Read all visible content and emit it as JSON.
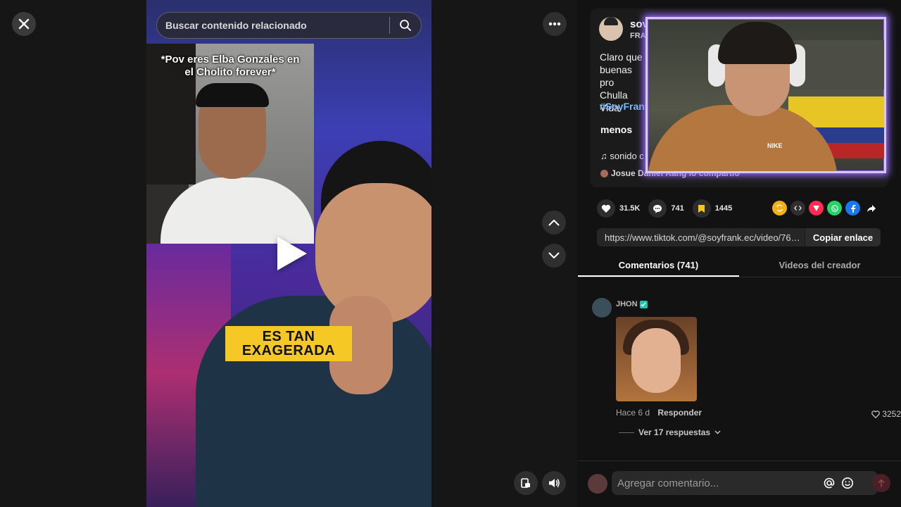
{
  "search": {
    "placeholder": "Buscar contenido relacionado"
  },
  "video": {
    "overlay_caption": "*Pov eres Elba Gonzales en el Cholito forever*",
    "sticker_line1": "ES TAN",
    "sticker_line2": "EXAGERADA",
    "inset_shirt_logo": "NIKE"
  },
  "author": {
    "username": "sov",
    "subname": "FRA",
    "description": "Claro que\nbuenas pro\nChulla Vida",
    "hashtag": "#SoyFrank",
    "less_label": "menos",
    "sound": "sonido c",
    "shared_by": "Josue Daniel Kang lo compartió"
  },
  "actions": {
    "likes": "31.5K",
    "comments": "741",
    "saves": "1445"
  },
  "link": {
    "url": "https://www.tiktok.com/@soyfrank.ec/video/76190...",
    "copy_label": "Copiar enlace"
  },
  "tabs": {
    "comments": "Comentarios (741)",
    "creator_videos": "Videos del creador"
  },
  "comment": {
    "author": "JHON",
    "time": "Hace 6 d",
    "reply_label": "Responder",
    "likes": "3252",
    "view_replies": "Ver 17 respuestas"
  },
  "composer": {
    "placeholder": "Agregar comentario..."
  },
  "cam": {
    "shirt_logo": "NIKE"
  },
  "colors": {
    "accent": "#fe2c55",
    "hashtag": "#7ab8ff",
    "sticker": "#f5c825",
    "cam_border": "#9a6cff"
  },
  "icons": [
    "close-icon",
    "search-icon",
    "more-icon",
    "chevron-up-icon",
    "chevron-down-icon",
    "pip-icon",
    "volume-icon",
    "heart-icon",
    "comment-icon",
    "bookmark-icon",
    "music-icon",
    "send-icon",
    "at-icon",
    "emoji-icon",
    "play-icon"
  ]
}
